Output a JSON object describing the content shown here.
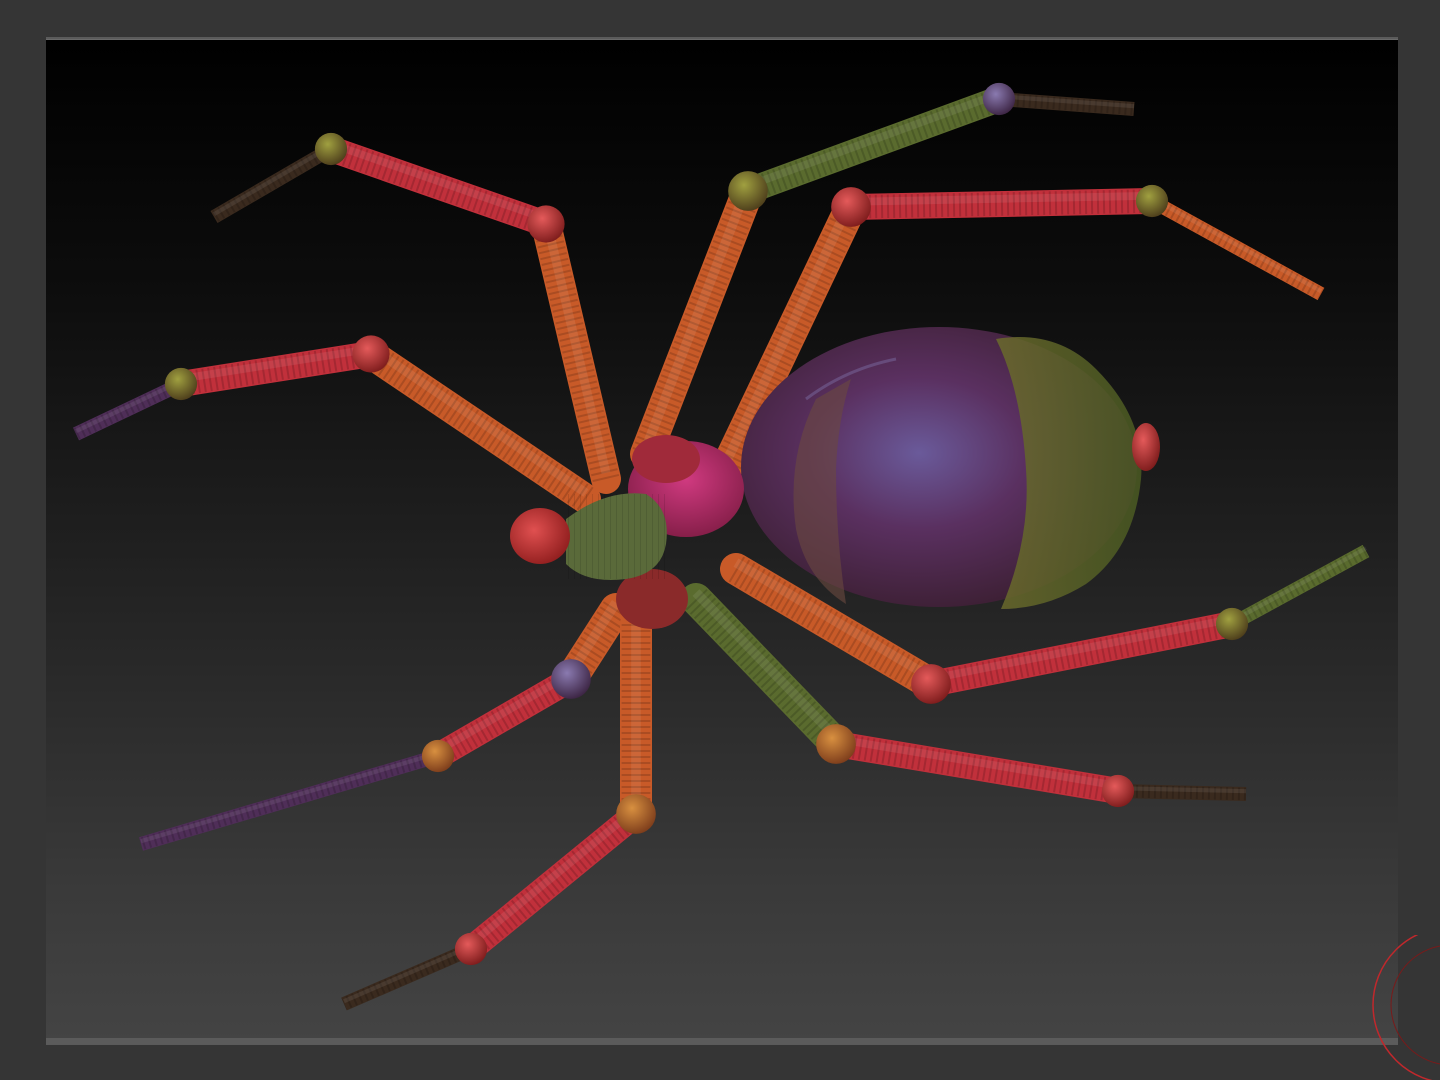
{
  "viewport": {
    "model_name": "spider-model",
    "background_top": "#000000",
    "background_bottom": "#444444"
  },
  "model": {
    "palette": {
      "red": "#c1303b",
      "orange": "#c85a28",
      "green": "#5a6b2e",
      "purple": "#4f2e58",
      "magenta": "#b02e6a",
      "tip": "#3a2a1e"
    }
  },
  "gizmo": {
    "ring_color": "#c0282c",
    "icon": "navigation-ring-icon"
  }
}
